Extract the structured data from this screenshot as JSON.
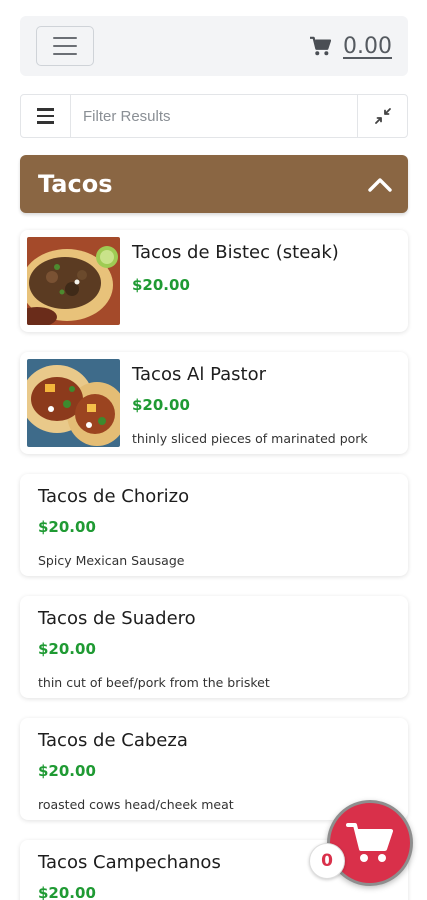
{
  "header": {
    "cart_total": "0.00",
    "menu_icon": "hamburger-icon",
    "cart_icon": "cart-icon"
  },
  "filter": {
    "placeholder": "Filter Results",
    "value": ""
  },
  "category": {
    "title": "Tacos",
    "color": "#8a6643",
    "toggle_icon": "chevron-up-icon"
  },
  "items": [
    {
      "name": "Tacos de Bistec (steak)",
      "price": "$20.00",
      "description": ""
    },
    {
      "name": "Tacos Al Pastor",
      "price": "$20.00",
      "description": "thinly sliced pieces of marinated pork"
    },
    {
      "name": "Tacos de Chorizo",
      "price": "$20.00",
      "description": "Spicy Mexican Sausage"
    },
    {
      "name": "Tacos de Suadero",
      "price": "$20.00",
      "description": "thin cut of beef/pork from the brisket"
    },
    {
      "name": "Tacos de Cabeza",
      "price": "$20.00",
      "description": "roasted cows head/cheek meat"
    },
    {
      "name": "Tacos Campechanos",
      "price": "$20.00",
      "description": ""
    }
  ],
  "cart_fab": {
    "count": "0",
    "color": "#d9304a"
  },
  "colors": {
    "price_green": "#1f9a33"
  }
}
